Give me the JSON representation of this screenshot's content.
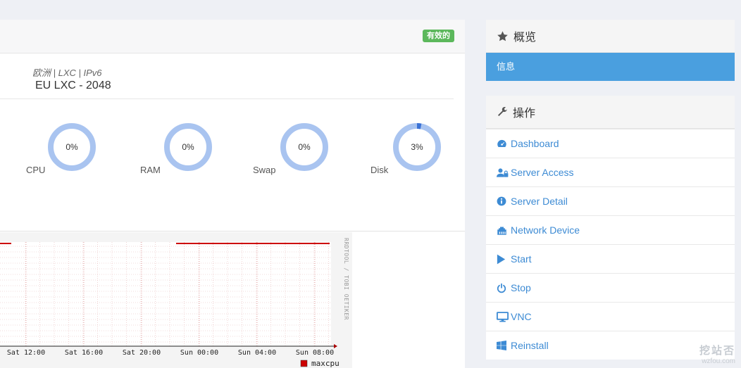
{
  "main": {
    "status_badge": "有效的",
    "plan_tags": "欧洲 | LXC | IPv6",
    "plan_name": "EU LXC - 2048",
    "usage": [
      {
        "label": "CPU",
        "value": "0%",
        "percent": 0
      },
      {
        "label": "RAM",
        "value": "0%",
        "percent": 0
      },
      {
        "label": "Swap",
        "value": "0%",
        "percent": 0
      },
      {
        "label": "Disk",
        "value": "3%",
        "percent": 3
      }
    ]
  },
  "graph": {
    "x_labels": [
      "Sat 12:00",
      "Sat 16:00",
      "Sat 20:00",
      "Sun 00:00",
      "Sun 04:00",
      "Sun 08:00"
    ],
    "side_label": "RRDTOOL / TOBI OETIKER",
    "legend": "maxcpu",
    "legend_color": "#cc0000"
  },
  "sidebar": {
    "overview_title": "概览",
    "overview_active": "信息",
    "actions_title": "操作",
    "actions": [
      {
        "label": "Dashboard",
        "icon": "dashboard-icon"
      },
      {
        "label": "Server Access",
        "icon": "user-lock-icon"
      },
      {
        "label": "Server Detail",
        "icon": "info-circle-icon"
      },
      {
        "label": "Network Device",
        "icon": "network-device-icon"
      },
      {
        "label": "Start",
        "icon": "play-icon"
      },
      {
        "label": "Stop",
        "icon": "power-icon"
      },
      {
        "label": "VNC",
        "icon": "monitor-icon"
      },
      {
        "label": "Reinstall",
        "icon": "windows-icon"
      }
    ]
  },
  "watermark": {
    "line1": "挖站否",
    "line2": "wzfou.com"
  },
  "colors": {
    "accent": "#4a9fdf",
    "link": "#3d8bd4",
    "success": "#5cb85c",
    "gauge_track": "#a9c4f0",
    "gauge_fill": "#3a72d6"
  }
}
